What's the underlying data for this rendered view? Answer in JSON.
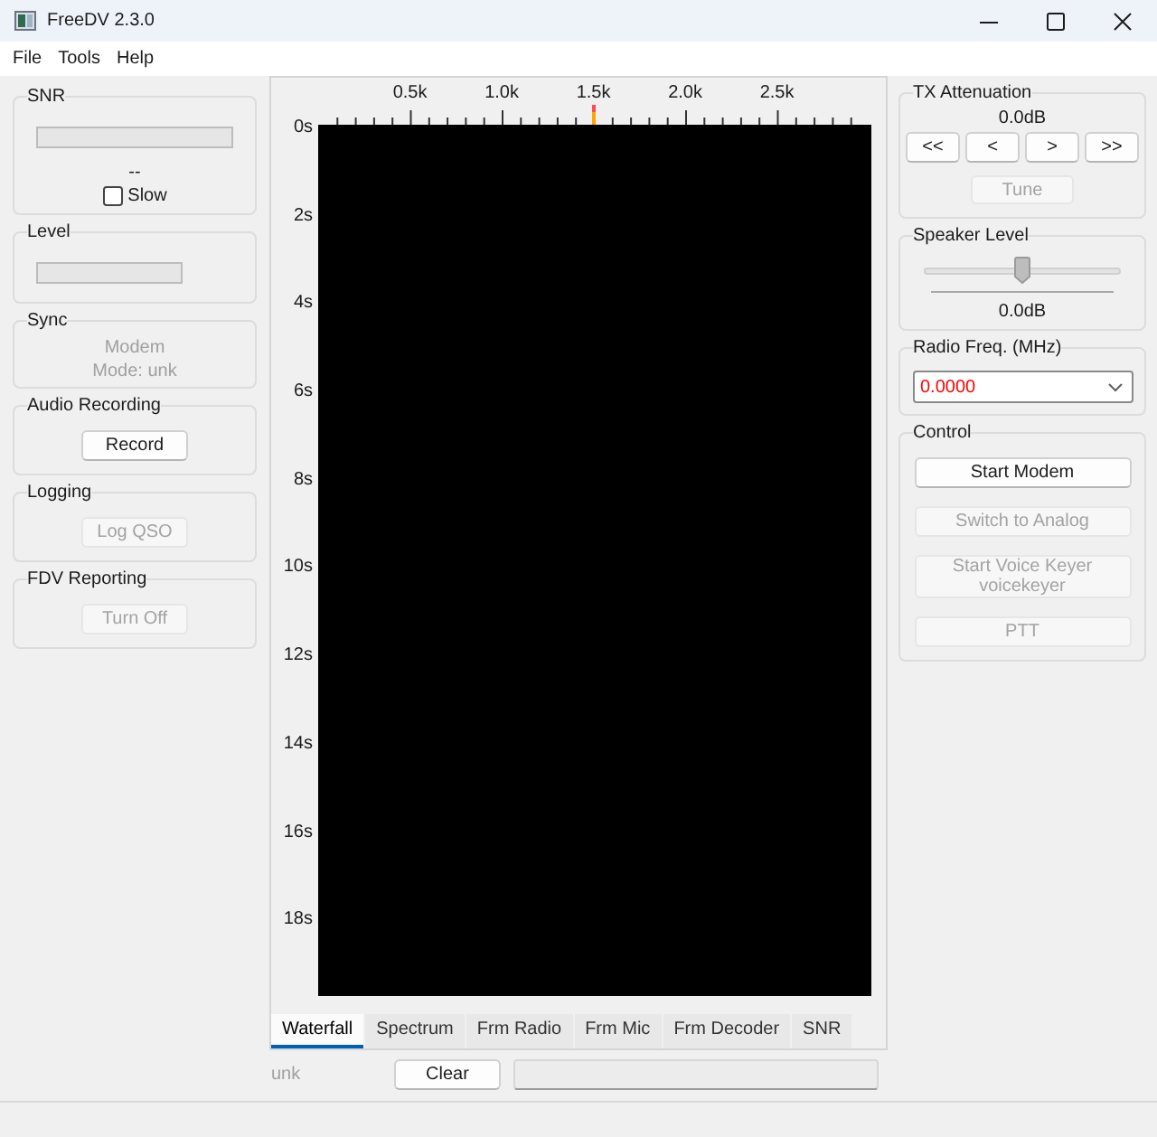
{
  "window": {
    "title": "FreeDV 2.3.0"
  },
  "menu": [
    "File",
    "Tools",
    "Help"
  ],
  "left_groups": [
    {
      "kind": "snr",
      "title": "SNR",
      "reading": "--",
      "checkbox": {
        "label": "Slow",
        "checked": false
      }
    },
    {
      "kind": "meter",
      "title": "Level"
    },
    {
      "kind": "sync",
      "title": "Sync",
      "synced": false,
      "lines": [
        "Modem",
        "Mode: unk"
      ]
    },
    {
      "kind": "button",
      "title": "Audio Recording",
      "button": {
        "label": "Record",
        "disabled": false
      }
    },
    {
      "kind": "button",
      "title": "Logging",
      "button": {
        "label": "Log QSO",
        "disabled": true
      }
    },
    {
      "kind": "button",
      "title": "FDV Reporting",
      "button": {
        "label": "Turn Off",
        "disabled": true
      }
    }
  ],
  "waterfall": {
    "freq_labels": [
      "0.5k",
      "1.0k",
      "1.5k",
      "2.0k",
      "2.5k"
    ],
    "time_labels": [
      "0s",
      "2s",
      "4s",
      "6s",
      "8s",
      "10s",
      "12s",
      "14s",
      "16s",
      "18s"
    ]
  },
  "tabs": [
    {
      "label": "Waterfall",
      "selected": true
    },
    {
      "label": "Spectrum",
      "selected": false
    },
    {
      "label": "Frm Radio",
      "selected": false
    },
    {
      "label": "Frm Mic",
      "selected": false
    },
    {
      "label": "Frm Decoder",
      "selected": false
    },
    {
      "label": "SNR",
      "selected": false
    }
  ],
  "status_row": {
    "text": "unk",
    "clear_button": "Clear"
  },
  "right_groups": [
    {
      "kind": "attenuation",
      "title": "TX Attenuation",
      "reading": "0.0dB",
      "step_buttons": [
        "<<",
        "<",
        ">",
        ">>"
      ],
      "tune": {
        "label": "Tune",
        "disabled": true
      }
    },
    {
      "kind": "slider",
      "title": "Speaker Level",
      "level": 0.5,
      "reading": "0.0dB"
    },
    {
      "kind": "frequency",
      "title": "Radio Freq. (MHz)",
      "value": "0.0000",
      "valid": false
    },
    {
      "kind": "controls",
      "title": "Control",
      "buttons": [
        {
          "label": "Start Modem",
          "disabled": false
        },
        {
          "label": "Switch to Analog",
          "disabled": true
        },
        {
          "label": "Start Voice Keyer",
          "second_line": "voicekeyer",
          "disabled": true
        },
        {
          "label": "PTT",
          "disabled": true
        }
      ]
    }
  ]
}
